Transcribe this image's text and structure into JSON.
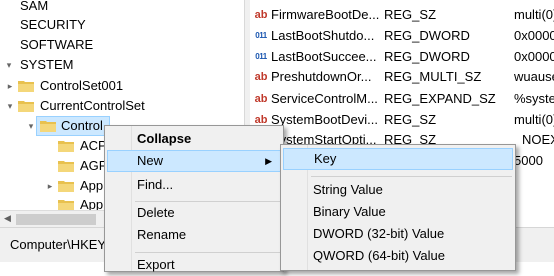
{
  "tree": {
    "items": [
      {
        "label": "SAM",
        "expander": ""
      },
      {
        "label": "SECURITY",
        "expander": ""
      },
      {
        "label": "SOFTWARE",
        "expander": ""
      },
      {
        "label": "SYSTEM",
        "expander": "▾"
      },
      {
        "label": "ControlSet001",
        "expander": "▸"
      },
      {
        "label": "CurrentControlSet",
        "expander": "▾"
      },
      {
        "label": "Control",
        "expander": "▾"
      },
      {
        "label": "ACP",
        "expander": ""
      },
      {
        "label": "AGP",
        "expander": ""
      },
      {
        "label": "App",
        "expander": "▸"
      },
      {
        "label": "App",
        "expander": ""
      }
    ]
  },
  "values": {
    "rows": [
      {
        "icon": "ab",
        "name": "FirmwareBootDe...",
        "type": "REG_SZ",
        "data": "multi(0)"
      },
      {
        "icon": "bin",
        "name": "LastBootShutdo...",
        "type": "REG_DWORD",
        "data": "0x0000"
      },
      {
        "icon": "bin",
        "name": "LastBootSuccee...",
        "type": "REG_DWORD",
        "data": "0x0000"
      },
      {
        "icon": "ab",
        "name": "PreshutdownOr...",
        "type": "REG_MULTI_SZ",
        "data": "wuause"
      },
      {
        "icon": "ab",
        "name": "ServiceControlM...",
        "type": "REG_EXPAND_SZ",
        "data": "%syste"
      },
      {
        "icon": "ab",
        "name": "SystemBootDevi...",
        "type": "REG_SZ",
        "data": "multi(0)"
      },
      {
        "icon": "ab",
        "name": "SystemStartOpti...",
        "type": "REG_SZ",
        "data": "NOEX"
      },
      {
        "icon": "bin",
        "name": "",
        "type": "",
        "data": "5000"
      }
    ]
  },
  "status": {
    "path": "Computer\\HKEY"
  },
  "context_menu": {
    "collapse": "Collapse",
    "new": "New",
    "find": "Find...",
    "delete": "Delete",
    "rename": "Rename",
    "export": "Export"
  },
  "new_submenu": {
    "key": "Key",
    "string_value": "String Value",
    "binary_value": "Binary Value",
    "dword_value": "DWORD (32-bit) Value",
    "qword_value": "QWORD (64-bit) Value"
  },
  "colors": {
    "highlight": "#cce8ff",
    "highlight_border": "#99d1ff",
    "folder": "#e8c14f"
  }
}
